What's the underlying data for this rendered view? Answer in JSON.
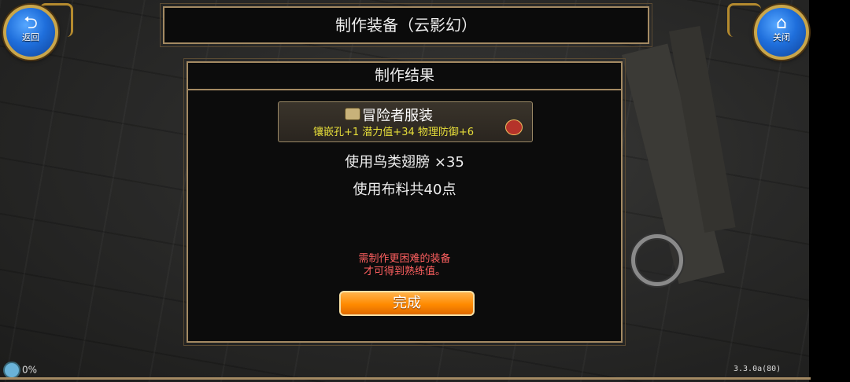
{
  "top_left_button": {
    "label": "返回",
    "icon": "back-arrow-icon"
  },
  "top_right_button": {
    "label": "关闭",
    "icon": "home-icon"
  },
  "window_title": "制作装备（云影幻）",
  "result_panel": {
    "header": "制作结果",
    "item": {
      "name": "冒险者服装",
      "stats": "镶嵌孔+1  潜力值+34  物理防御+6",
      "name_color": "#ffffff",
      "stats_color": "#e8df3a"
    },
    "used_material": "使用鸟类翅膀  ×35",
    "used_cloth": "使用布料共40点",
    "warning_line1": "需制作更困难的装备",
    "warning_line2": "才可得到熟练值。",
    "warning_color": "#ff6060",
    "done_button": "完成"
  },
  "status": {
    "percent": "0%"
  },
  "version": "3.3.0a(80)"
}
